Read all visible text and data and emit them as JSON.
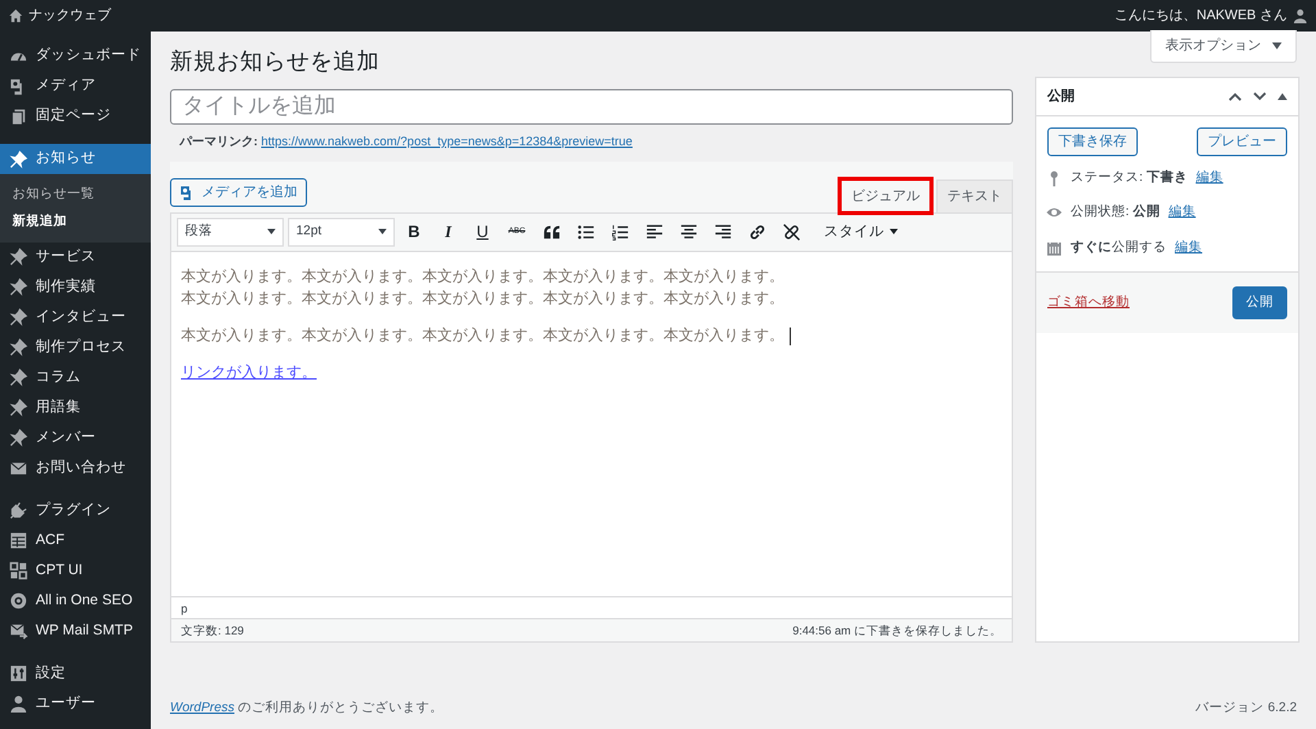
{
  "admin_bar": {
    "site_name": "ナックウェブ",
    "greeting": "こんにちは、NAKWEB さん"
  },
  "sidebar": {
    "groups": [
      [
        {
          "label": "ダッシュボード",
          "kind": "dashboard",
          "selected": false
        },
        {
          "label": "メディア",
          "kind": "media",
          "selected": false
        },
        {
          "label": "固定ページ",
          "kind": "pages",
          "selected": false
        }
      ],
      [
        {
          "label": "お知らせ",
          "kind": "pin",
          "selected": true,
          "submenu": [
            {
              "label": "お知らせ一覧",
              "selected": false
            },
            {
              "label": "新規追加",
              "selected": true
            }
          ]
        },
        {
          "label": "サービス",
          "kind": "pin",
          "selected": false
        },
        {
          "label": "制作実績",
          "kind": "pin",
          "selected": false
        },
        {
          "label": "インタビュー",
          "kind": "pin",
          "selected": false
        },
        {
          "label": "制作プロセス",
          "kind": "pin",
          "selected": false
        },
        {
          "label": "コラム",
          "kind": "pin",
          "selected": false
        },
        {
          "label": "用語集",
          "kind": "pin",
          "selected": false
        },
        {
          "label": "メンバー",
          "kind": "pin",
          "selected": false
        },
        {
          "label": "お問い合わせ",
          "kind": "mail",
          "selected": false
        }
      ],
      [
        {
          "label": "プラグイン",
          "kind": "plugin",
          "selected": false
        },
        {
          "label": "ACF",
          "kind": "acf",
          "selected": false
        },
        {
          "label": "CPT UI",
          "kind": "cpt",
          "selected": false
        },
        {
          "label": "All in One SEO",
          "kind": "seo",
          "selected": false
        },
        {
          "label": "WP Mail SMTP",
          "kind": "smtp",
          "selected": false
        }
      ],
      [
        {
          "label": "設定",
          "kind": "settings",
          "selected": false
        },
        {
          "label": "ユーザー",
          "kind": "user",
          "selected": false
        }
      ]
    ]
  },
  "screen_options": "表示オプション",
  "page_title": "新規お知らせを追加",
  "title_field": {
    "placeholder": "タイトルを追加"
  },
  "permalink": {
    "label": "パーマリンク:",
    "url": "https://www.nakweb.com/?post_type=news&p=12384&preview=true"
  },
  "editor": {
    "media_button": "メディアを追加",
    "tabs": [
      {
        "label": "ビジュアル",
        "selected": true,
        "highlighted": true
      },
      {
        "label": "テキスト",
        "selected": false,
        "highlighted": false
      }
    ],
    "format_select": "段落",
    "size_select": "12pt",
    "tools": [
      {
        "kind": "bold",
        "label": "B"
      },
      {
        "kind": "italic",
        "label": "I"
      },
      {
        "kind": "underline",
        "label": "U"
      },
      {
        "kind": "strike",
        "label": "ABC"
      },
      {
        "kind": "quote"
      },
      {
        "kind": "bullets"
      },
      {
        "kind": "numbers"
      },
      {
        "kind": "align-left"
      },
      {
        "kind": "align-center"
      },
      {
        "kind": "align-right"
      },
      {
        "kind": "link"
      },
      {
        "kind": "unlink"
      },
      {
        "kind": "styles",
        "label": "スタイル"
      }
    ],
    "content": [
      {
        "kind": "text",
        "cursor": false,
        "lines": [
          "本文が入ります。本文が入ります。本文が入ります。本文が入ります。本文が入ります。",
          "本文が入ります。本文が入ります。本文が入ります。本文が入ります。本文が入ります。"
        ]
      },
      {
        "kind": "text",
        "cursor": true,
        "lines": [
          "本文が入ります。本文が入ります。本文が入ります。本文が入ります。本文が入ります。"
        ]
      },
      {
        "kind": "link",
        "cursor": false,
        "lines": [
          "リンクが入ります。"
        ]
      }
    ],
    "path": "p",
    "word_count": "文字数: 129",
    "autosave": "9:44:56 am に下書きを保存しました。"
  },
  "publish_box": {
    "title": "公開",
    "save_draft": "下書き保存",
    "preview": "プレビュー",
    "rows": [
      {
        "kind": "status",
        "text": "ステータス: **下書き**",
        "link": "編集"
      },
      {
        "kind": "visibility",
        "text": "公開状態: **公開**",
        "link": "編集"
      },
      {
        "kind": "schedule",
        "text": "**すぐに**公開する",
        "link": "編集"
      }
    ],
    "trash": "ゴミ箱へ移動",
    "publish": "公開"
  },
  "footer": {
    "link": "WordPress",
    "text": " のご利用ありがとうございます。",
    "version": "バージョン 6.2.2"
  }
}
